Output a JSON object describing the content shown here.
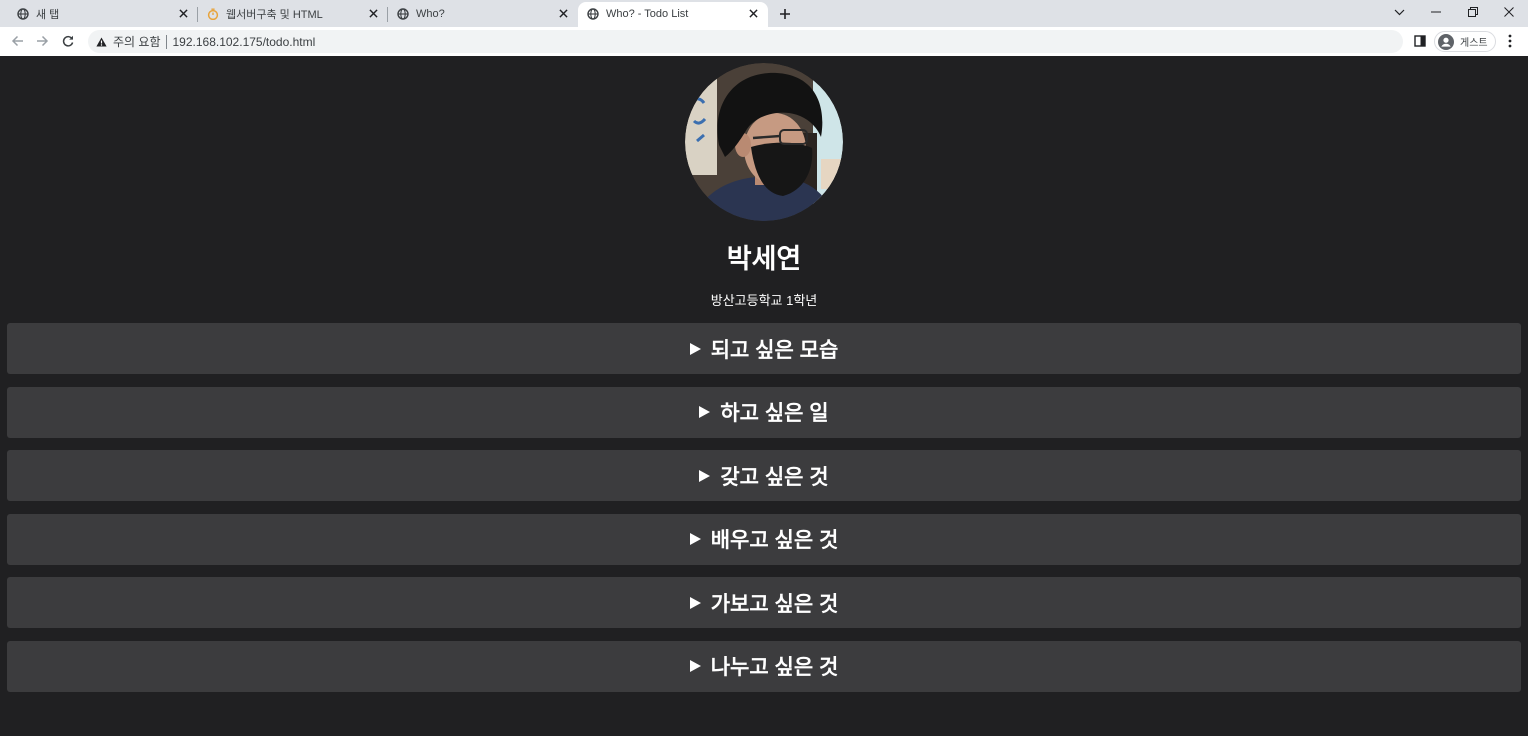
{
  "browser": {
    "tabs": [
      {
        "title": "새 탭",
        "icon": "globe-icon",
        "active": false
      },
      {
        "title": "웹서버구축 및 HTML",
        "icon": "timer-icon",
        "active": false
      },
      {
        "title": "Who?",
        "icon": "globe-icon",
        "active": false
      },
      {
        "title": "Who? - Todo List",
        "icon": "globe-icon",
        "active": true
      }
    ],
    "new_tab_icon": "plus-icon",
    "nav_icons": [
      "back-arrow-icon",
      "forward-arrow-icon",
      "reload-icon"
    ],
    "security_icon": "warning-icon",
    "security_label": "주의 요함",
    "url": "192.168.102.175/todo.html",
    "profile_icon": "account-icon",
    "profile_label": "게스트"
  },
  "page": {
    "name": "박세연",
    "subtitle": "방산고등학교 1학년",
    "sections": [
      {
        "label": "되고 싶은 모습",
        "expanded": false
      },
      {
        "label": "하고 싶은 일",
        "expanded": false
      },
      {
        "label": "갖고 싶은 것",
        "expanded": false
      },
      {
        "label": "배우고 싶은 것",
        "expanded": false
      },
      {
        "label": "가보고 싶은 것",
        "expanded": false
      },
      {
        "label": "나누고 싶은 것",
        "expanded": false
      }
    ]
  },
  "colors": {
    "tabbar_bg": "#dee1e6",
    "toolbar_bg": "#ffffff",
    "omnibox_bg": "#f1f3f4",
    "page_bg": "#202022",
    "section_bg": "#3c3c3e",
    "page_text": "#ffffff",
    "timer_icon": "#e8a33a"
  }
}
